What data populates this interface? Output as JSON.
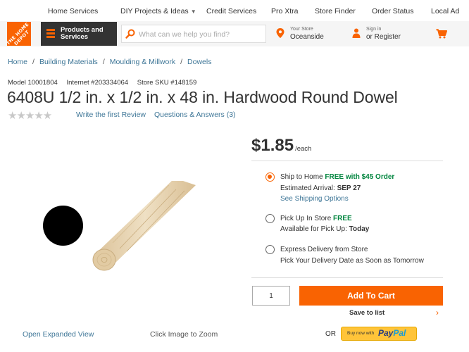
{
  "top_nav": {
    "items": [
      "Home Services",
      "DIY Projects & Ideas",
      "Credit Services",
      "Pro Xtra",
      "Store Finder",
      "Order Status",
      "Local Ad"
    ]
  },
  "header": {
    "logo_text": "THE HOME DEPOT",
    "products_label": "Products and Services",
    "search_placeholder": "What can we help you find?",
    "store_small": "Your Store",
    "store_name": "Oceanside",
    "signin_small": "Sign in",
    "signin_big": "or Register",
    "icons": {
      "menu": "hamburger-icon",
      "search": "search-icon",
      "store": "location-pin-icon",
      "account": "person-icon",
      "cart": "cart-icon"
    },
    "accent_color": "#f96302"
  },
  "breadcrumb": [
    "Home",
    "Building Materials",
    "Moulding & Millwork",
    "Dowels"
  ],
  "breadcrumb_separator": "/",
  "product": {
    "model": "Model 10001804",
    "internet": "Internet #203334064",
    "sku": "Store SKU #148159",
    "title": "6408U 1/2 in. x 1/2 in. x 48 in. Hardwood Round Dowel",
    "stars_display": "★★★★★",
    "rating": 0,
    "review_link": "Write the first Review",
    "qa_link": "Questions & Answers (3)",
    "expand_link": "Open Expanded View",
    "zoom_hint": "Click Image to Zoom"
  },
  "pricing": {
    "price": "$1.85",
    "unit": "/each"
  },
  "fulfillment": {
    "ship": {
      "label": "Ship to Home ",
      "free": "FREE with $45 Order",
      "arrival_prefix": "Estimated Arrival: ",
      "arrival_date": "SEP 27",
      "link": "See Shipping Options",
      "selected": true
    },
    "pickup": {
      "label": "Pick Up In Store ",
      "free": "FREE",
      "avail_prefix": "Available for Pick Up: ",
      "avail_value": "Today",
      "selected": false
    },
    "express": {
      "label": "Express Delivery from Store",
      "sub": "Pick Your Delivery Date as Soon as Tomorrow",
      "selected": false
    }
  },
  "purchase": {
    "quantity": "1",
    "add_to_cart": "Add To Cart",
    "save_to_list": "Save to list",
    "save_chevron": "›",
    "or": "OR",
    "paypal_small": "Buy now with",
    "paypal_pay": "Pay",
    "paypal_pal": "Pal",
    "paypal_color": "#ffc439"
  }
}
